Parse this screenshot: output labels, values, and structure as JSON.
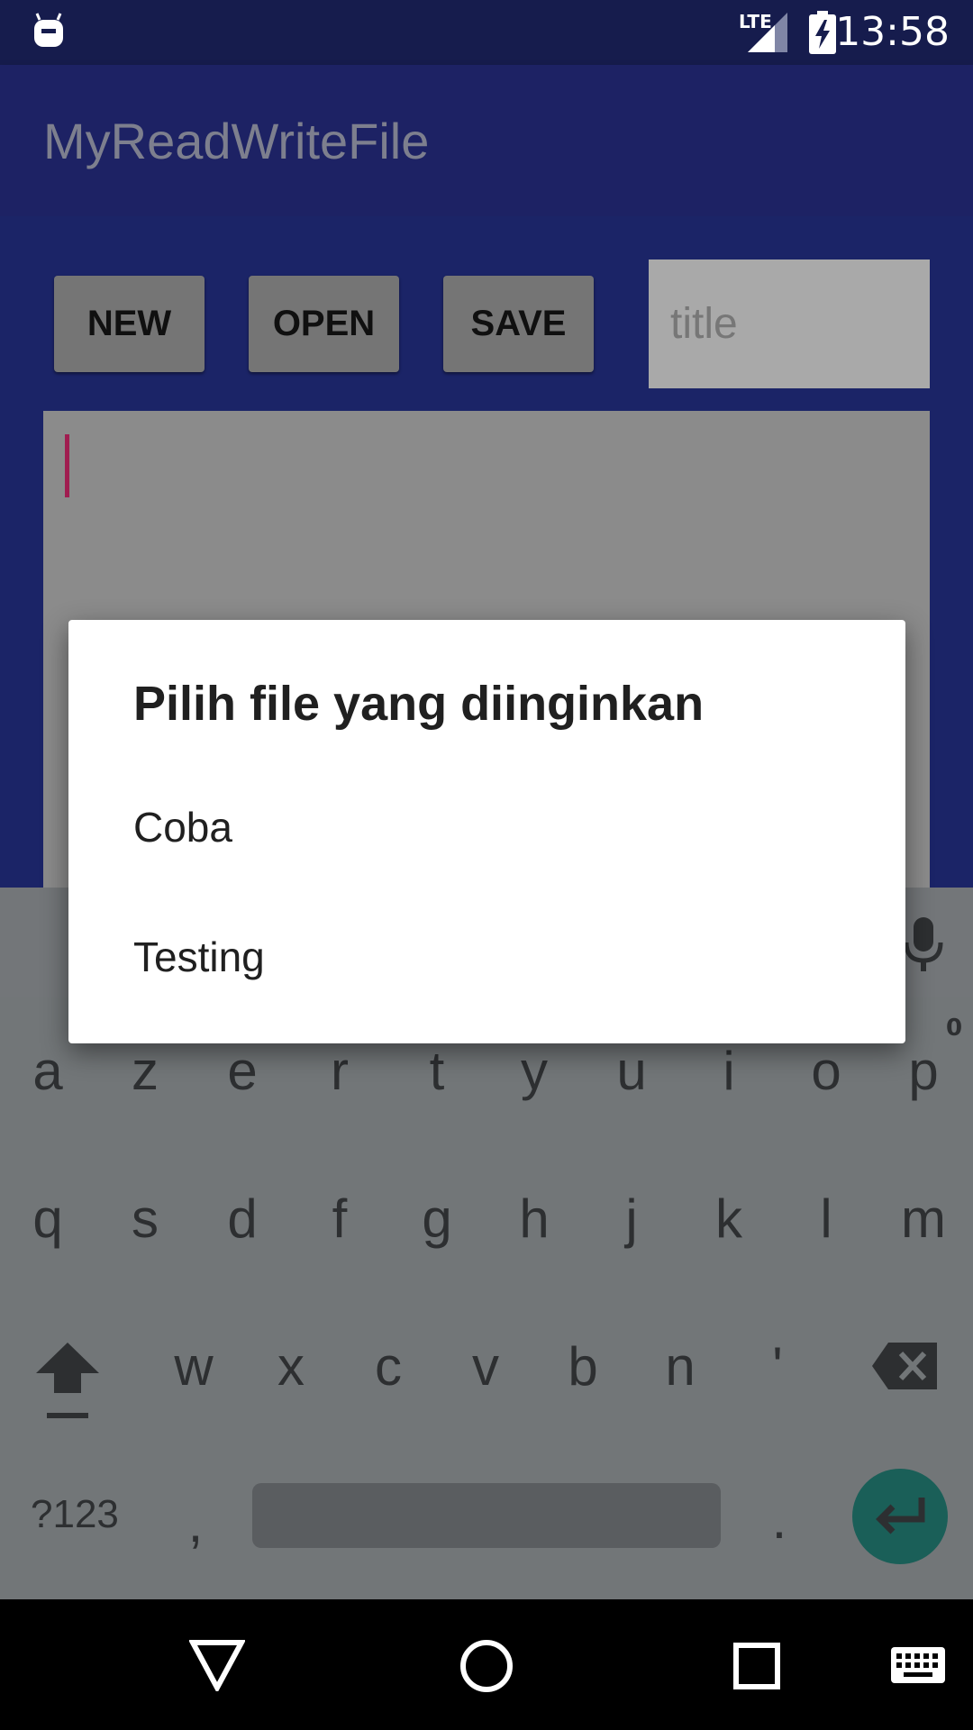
{
  "status_bar": {
    "network": "LTE",
    "time": "13:58",
    "icons": [
      "android-notification-icon",
      "lte-signal-icon",
      "battery-charging-icon"
    ]
  },
  "app_bar": {
    "title": "MyReadWriteFile"
  },
  "toolbar": {
    "new_label": "NEW",
    "open_label": "OPEN",
    "save_label": "SAVE",
    "title_placeholder": "title"
  },
  "dialog": {
    "title": "Pilih file yang diinginkan",
    "items": [
      "Coba",
      "Testing"
    ]
  },
  "keyboard": {
    "row1": [
      "a",
      "z",
      "e",
      "r",
      "t",
      "y",
      "u",
      "i",
      "o",
      "p"
    ],
    "row1_hint": "0",
    "row2": [
      "q",
      "s",
      "d",
      "f",
      "g",
      "h",
      "j",
      "k",
      "l",
      "m"
    ],
    "row3": [
      "w",
      "x",
      "c",
      "v",
      "b",
      "n",
      "'"
    ],
    "symbols_label": "?123",
    "comma": ",",
    "period": ".",
    "icons": [
      "shift-icon",
      "backspace-icon",
      "microphone-icon",
      "enter-icon"
    ]
  },
  "nav_bar": {
    "icons": [
      "back-icon",
      "home-icon",
      "recents-icon",
      "keyboard-icon"
    ]
  },
  "colors": {
    "primary": "#1d2264",
    "status_bar": "#161c4d",
    "accent": "#a01d50",
    "enter_key": "#1a5f58"
  }
}
